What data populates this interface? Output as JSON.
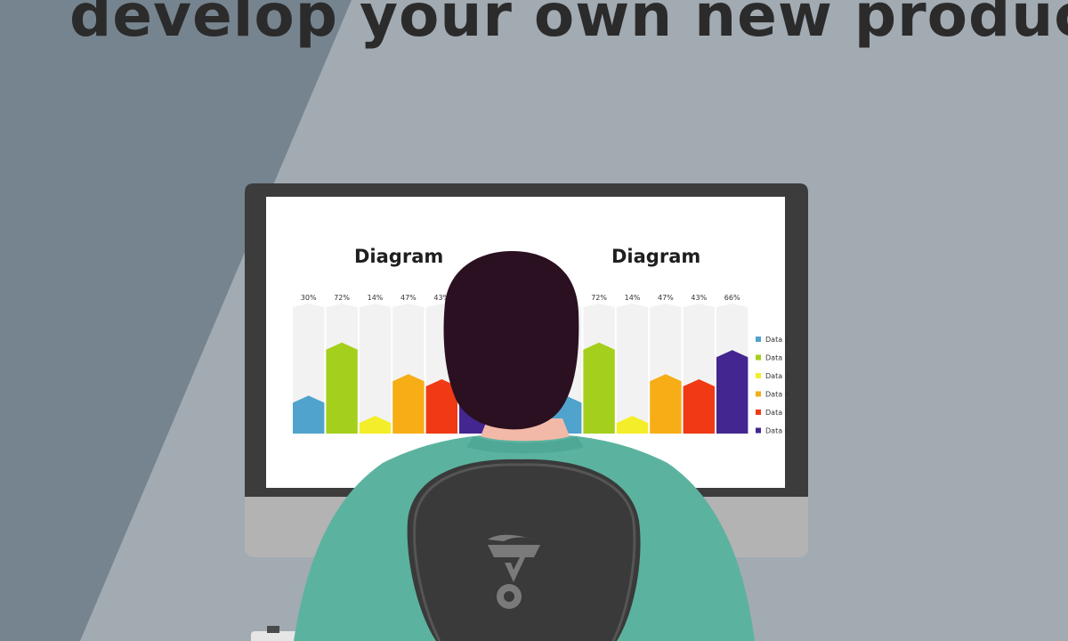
{
  "headline": "develop your own new product",
  "colors": {
    "background": "#a2aab2",
    "shadow": "#76848f",
    "monitor_bezel": "#3c3c3c",
    "monitor_chin": "#b3b3b3",
    "screen": "#ffffff",
    "hair": "#2a1020",
    "shirt": "#5bb39f",
    "chair": "#3c3c3c",
    "chair_logo": "#7a7a7a"
  },
  "left_panel": {
    "title": "Diagram"
  },
  "right_panel": {
    "title": "Diagram"
  },
  "chart_data": [
    {
      "type": "bar",
      "title": "Diagram",
      "categories": [
        "Data 1",
        "Data 2",
        "Data 3",
        "Data 4",
        "Data 5",
        "Data 6"
      ],
      "values": [
        30,
        72,
        14,
        47,
        43,
        66
      ],
      "value_labels": [
        "30%",
        "72%",
        "14%",
        "47%",
        "43%",
        ""
      ],
      "colors": [
        "#4fa3cc",
        "#a4cf1c",
        "#f4ee2a",
        "#f6ad16",
        "#ef3a14",
        "#43268f"
      ],
      "ylim": [
        0,
        100
      ]
    },
    {
      "type": "bar",
      "title": "Diagram",
      "categories": [
        "Data 1",
        "Data 2",
        "Data 3",
        "Data 4",
        "Data 5",
        "Data 6"
      ],
      "values": [
        30,
        72,
        14,
        47,
        43,
        66
      ],
      "value_labels": [
        "%",
        "72%",
        "14%",
        "47%",
        "43%",
        "66%"
      ],
      "legend": [
        "Data 1",
        "Data 2",
        "Data 3",
        "Data 4",
        "Data 5",
        "Data 6"
      ],
      "legend_visible": [
        "Data 1",
        "Data 2",
        "Data 3",
        "Data 4",
        "Data 5",
        "Data 6"
      ],
      "colors": [
        "#4fa3cc",
        "#a4cf1c",
        "#f4ee2a",
        "#f6ad16",
        "#ef3a14",
        "#43268f"
      ],
      "ylim": [
        0,
        100
      ],
      "legend_position": "right"
    }
  ]
}
